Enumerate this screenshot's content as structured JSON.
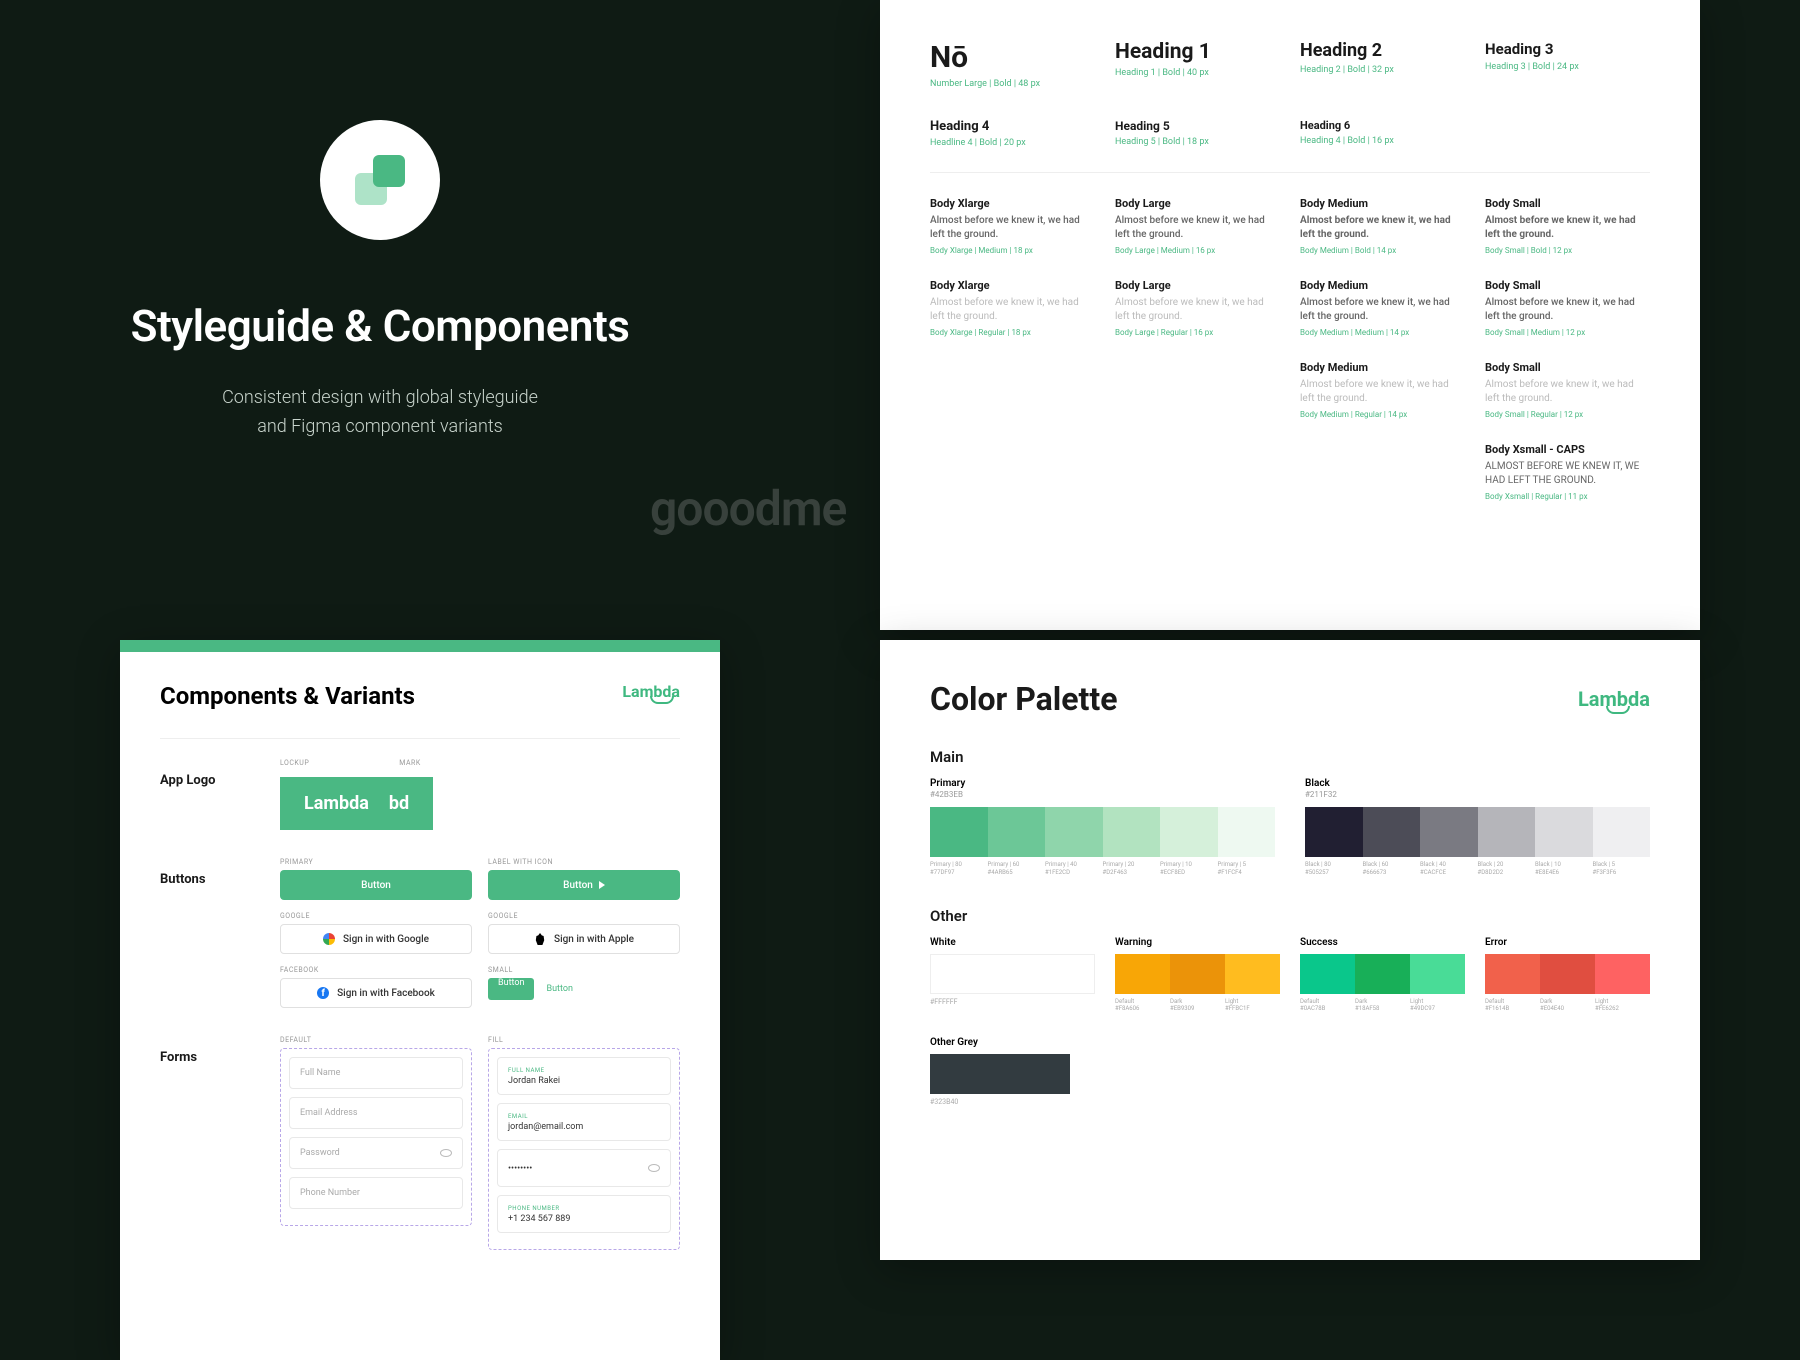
{
  "watermark": "gooodme",
  "intro": {
    "title": "Styleguide & Components",
    "subtitle": "Consistent design with global styleguide\nand Figma component variants"
  },
  "brand": "Lambda",
  "typography": {
    "headings": [
      {
        "sample": "Nō",
        "meta": "Number Large | Bold | 48 px",
        "size": 30
      },
      {
        "sample": "Heading 1",
        "meta": "Heading 1 | Bold | 40 px",
        "size": 21
      },
      {
        "sample": "Heading 2",
        "meta": "Heading 2 | Bold | 32 px",
        "size": 18
      },
      {
        "sample": "Heading 3",
        "meta": "Heading 3 | Bold | 24 px",
        "size": 15
      },
      {
        "sample": "Heading 4",
        "meta": "Headline 4 | Bold | 20 px",
        "size": 13
      },
      {
        "sample": "Heading 5",
        "meta": "Heading 5 | Bold | 18 px",
        "size": 12
      },
      {
        "sample": "Heading 6",
        "meta": "Heading 4 | Bold | 16 px",
        "size": 11
      }
    ],
    "body_sample": "Almost before we knew it, we had left the ground.",
    "body_sample_caps": "ALMOST BEFORE WE KNEW IT, WE HAD LEFT THE GROUND.",
    "body": [
      [
        {
          "label": "Body Xlarge",
          "meta": "Body Xlarge | Medium | 18 px",
          "weight": 500
        },
        {
          "label": "Body Large",
          "meta": "Body Large | Medium | 16 px",
          "weight": 500
        },
        {
          "label": "Body Medium",
          "meta": "Body Medium | Bold | 14 px",
          "weight": 700
        },
        {
          "label": "Body Small",
          "meta": "Body Small | Bold | 12 px",
          "weight": 700
        }
      ],
      [
        {
          "label": "Body Xlarge",
          "meta": "Body Xlarge | Regular | 18 px",
          "weight": 400,
          "light": true
        },
        {
          "label": "Body Large",
          "meta": "Body Large | Regular | 16 px",
          "weight": 400,
          "light": true
        },
        {
          "label": "Body Medium",
          "meta": "Body Medium | Medium | 14 px",
          "weight": 500
        },
        {
          "label": "Body Small",
          "meta": "Body Small | Medium | 12 px",
          "weight": 500
        }
      ],
      [
        null,
        null,
        {
          "label": "Body Medium",
          "meta": "Body Medium | Regular | 14 px",
          "weight": 400,
          "light": true
        },
        {
          "label": "Body Small",
          "meta": "Body Small | Regular | 12 px",
          "weight": 400,
          "light": true
        }
      ],
      [
        null,
        null,
        null,
        {
          "label": "Body Xsmall - CAPS",
          "meta": "Body Xsmall | Regular | 11 px",
          "caps": true
        }
      ]
    ]
  },
  "color": {
    "title": "Color Palette",
    "sections": {
      "main": "Main",
      "other": "Other"
    },
    "main": [
      {
        "name": "Primary",
        "hex": "#42B3EB",
        "shades": [
          "#77DF97",
          "#4ARB65",
          "#1FE2CD",
          "#D2F463",
          "#ECF8ED",
          "#F1FCF4"
        ],
        "labels": [
          "Primary | 80",
          "Primary | 60",
          "Primary | 40",
          "Primary | 20",
          "Primary | 10",
          "Primary | 5"
        ],
        "hexes": [
          "#77DF97",
          "#4ARB65",
          "#1FE2CD",
          "#D2F463",
          "#ECF8ED",
          "#F1FCF4"
        ]
      },
      {
        "name": "Black",
        "hex": "#211F32",
        "shades": [
          "#4C4C57",
          "#666673",
          "#9999A1",
          "#CCCCCF",
          "#E6E6E9",
          "#F3F3F5"
        ],
        "labels": [
          "Black | 80",
          "Black | 60",
          "Black | 40",
          "Black | 20",
          "Black | 10",
          "Black | 5"
        ],
        "hexes": [
          "#505257",
          "#666673",
          "#CACFCE",
          "#D8D2D2",
          "#E8E4E6",
          "#F3F3F6"
        ]
      }
    ],
    "white": {
      "name": "White",
      "hex": "#FFFFFF"
    },
    "status": [
      {
        "name": "Warning",
        "shades": [
          "#F8A606",
          "#EB9309",
          "#FFBC1F"
        ],
        "labels": [
          "Default",
          "Dark",
          "Light"
        ],
        "hexes": [
          "#F8A606",
          "#EB9309",
          "#FFBC1F"
        ]
      },
      {
        "name": "Success",
        "shades": [
          "#0AC78B",
          "#18AF58",
          "#49DC97"
        ],
        "labels": [
          "Default",
          "Dark",
          "Light"
        ],
        "hexes": [
          "#0AC78B",
          "#18AF58",
          "#49DC97"
        ]
      },
      {
        "name": "Error",
        "shades": [
          "#F1614B",
          "#E04E40",
          "#FE6262"
        ],
        "labels": [
          "Default",
          "Dark",
          "Light"
        ],
        "hexes": [
          "#F1614B",
          "#E04E40",
          "#FE6262"
        ]
      }
    ],
    "other_grey": {
      "name": "Other Grey",
      "hex": "#323B40",
      "color": "#323B40"
    }
  },
  "components": {
    "title": "Components & Variants",
    "sections": {
      "app_logo": "App Logo",
      "buttons": "Buttons",
      "forms": "Forms"
    },
    "logo": {
      "lockup_label": "LOCKUP",
      "mark_label": "MARK",
      "word": "Lambda",
      "mark": "bd"
    },
    "buttons": {
      "primary_label": "PRIMARY",
      "icon_label": "LABEL WITH ICON",
      "google_label": "GOOGLE",
      "apple_label": "GOOGLE",
      "facebook_label": "FACEBOOK",
      "small_label": "SMALL",
      "primary_text": "Button",
      "icon_text": "Button",
      "google_text": "Sign in with Google",
      "apple_text": "Sign in with Apple",
      "facebook_text": "Sign in with Facebook",
      "small_text": "Button",
      "link_text": "Button"
    },
    "forms": {
      "default_label": "DEFAULT",
      "fill_label": "FILL",
      "fields": [
        {
          "placeholder": "Full Name",
          "label": "FULL NAME",
          "value": "Jordan Rakei"
        },
        {
          "placeholder": "Email Address",
          "label": "EMAIL",
          "value": "jordan@email.com"
        },
        {
          "placeholder": "Password",
          "label": "",
          "value": "••••••••",
          "eye": true
        },
        {
          "placeholder": "Phone Number",
          "label": "PHONE NUMBER",
          "value": "+1 234 567 889"
        }
      ]
    }
  }
}
